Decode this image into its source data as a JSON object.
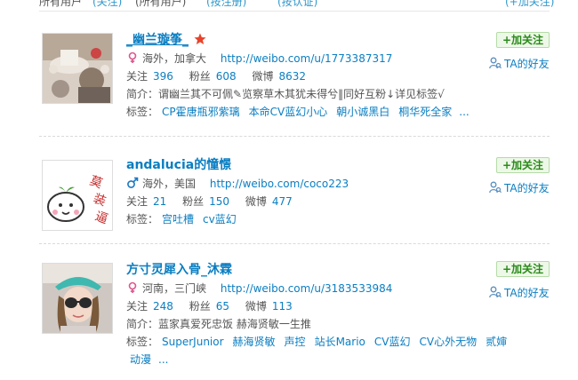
{
  "top_fragments": [
    "所有用户",
    "(关注)",
    "(所有用户)",
    "(按注册)",
    "(按认证)",
    "(+加关注)"
  ],
  "users": [
    {
      "name": "_幽兰璇筝_",
      "has_star": true,
      "gender": "female",
      "location": "海外，加拿大",
      "url": "http://weibo.com/u/1773387317",
      "following_label": "关注",
      "following": "396",
      "fans_label": "粉丝",
      "fans": "608",
      "posts_label": "微博",
      "posts": "8632",
      "intro_label": "简介：",
      "intro": "谓幽兰其不可佩✎览察草木其犹未得兮‖同好互粉↓详见标签√",
      "tags_label": "标签：",
      "tags": [
        "CP霍唐瓶邪紫璃",
        "本命CV蓝幻小心",
        "朝小诚黑白",
        "桐华死全家"
      ],
      "tags_more": "..."
    },
    {
      "name": "andalucia的憧憬",
      "has_star": false,
      "gender": "male",
      "location": "海外，美国",
      "url": "http://weibo.com/coco223",
      "following_label": "关注",
      "following": "21",
      "fans_label": "粉丝",
      "fans": "150",
      "posts_label": "微博",
      "posts": "477",
      "tags_label": "标签：",
      "tags": [
        "宫吐槽",
        "cv蓝幻"
      ],
      "tags_more": ""
    },
    {
      "name": "方寸灵犀入骨_沐霖",
      "has_star": false,
      "gender": "female",
      "location": "河南，三门峡",
      "url": "http://weibo.com/u/3183533984",
      "following_label": "关注",
      "following": "248",
      "fans_label": "粉丝",
      "fans": "65",
      "posts_label": "微博",
      "posts": "113",
      "intro_label": "简介：",
      "intro": "蓝家真爱死忠饭 赫海贤敏一生推",
      "tags_label": "标签：",
      "tags": [
        "SuperJunior",
        "赫海贤敏",
        "声控",
        "站长Mario",
        "CV蓝幻",
        "CV心外无物",
        "贰婶",
        "动漫"
      ],
      "tags_more": "..."
    }
  ],
  "follow_label": "+加关注",
  "ta_friends_label": "TA的好友",
  "colors": {
    "link": "#0a7ec2",
    "follow_bg": "#eef8e8",
    "follow_text": "#2a8a1a",
    "female": "#e0558c",
    "male": "#1a78c2"
  }
}
